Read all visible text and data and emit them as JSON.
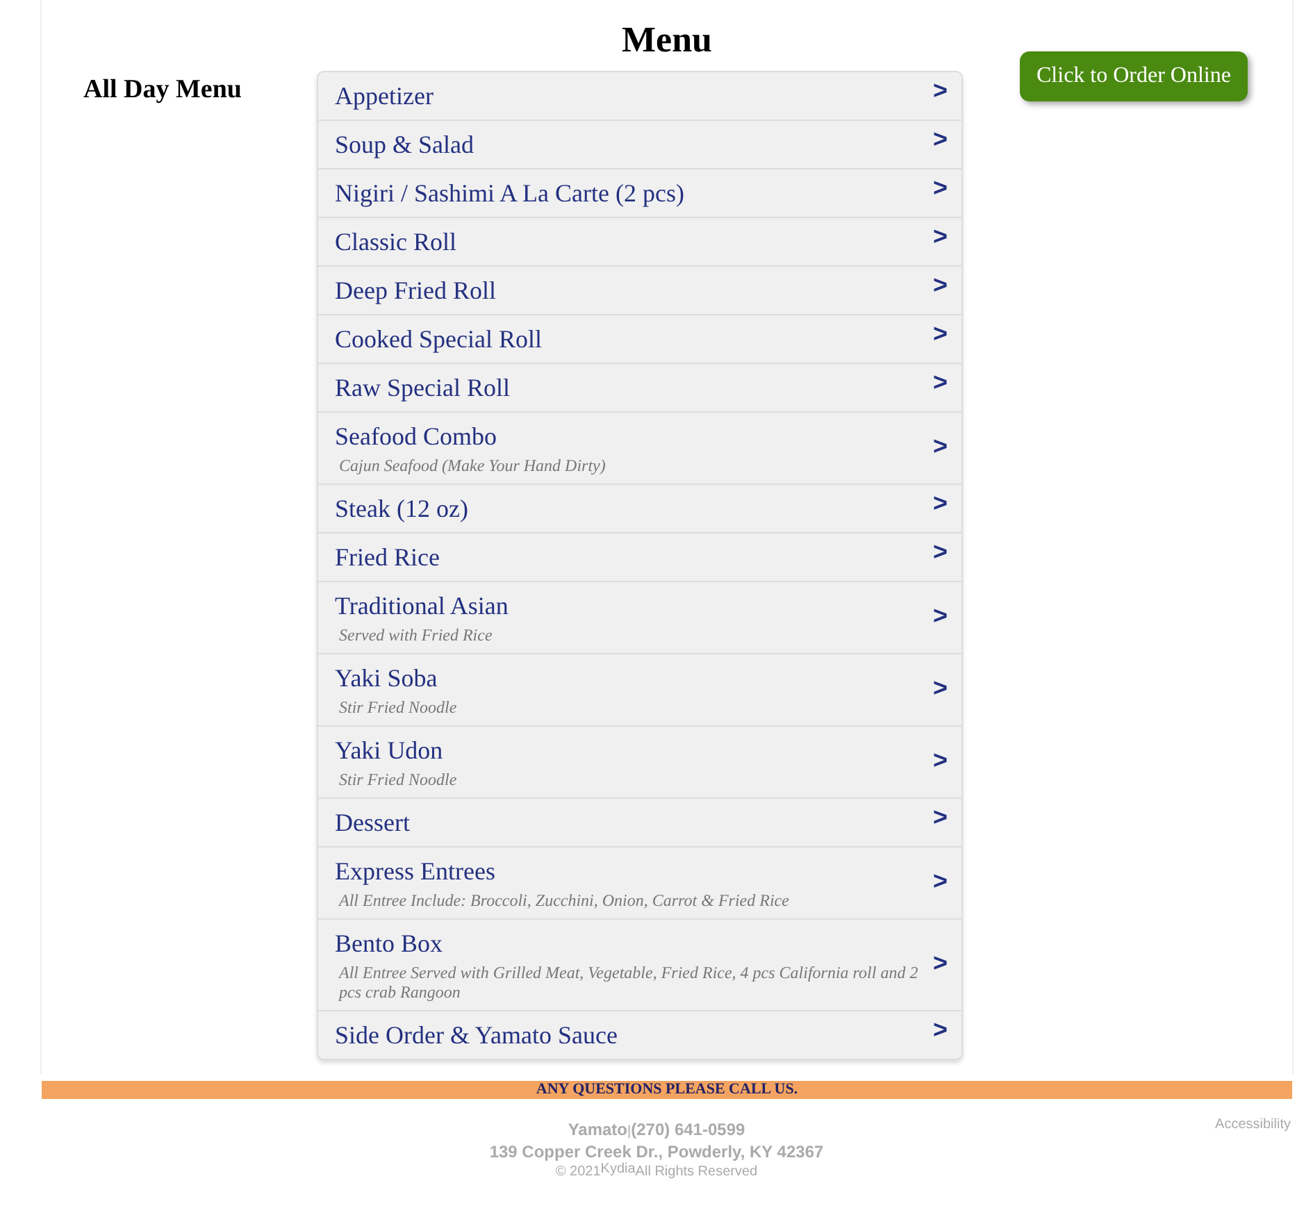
{
  "title": "Menu",
  "section": "All Day Menu",
  "order_button": "Click to Order Online",
  "categories": [
    {
      "name": "Appetizer",
      "arrow": ">"
    },
    {
      "name": "Soup & Salad",
      "arrow": ">"
    },
    {
      "name": "Nigiri / Sashimi A La Carte (2 pcs)",
      "arrow": ">"
    },
    {
      "name": "Classic Roll",
      "arrow": ">"
    },
    {
      "name": "Deep Fried Roll",
      "arrow": ">"
    },
    {
      "name": "Cooked Special Roll",
      "arrow": ">"
    },
    {
      "name": "Raw Special Roll",
      "arrow": ">"
    },
    {
      "name": "Seafood Combo",
      "description": "Cajun Seafood (Make Your Hand Dirty)",
      "arrow": ">"
    },
    {
      "name": "Steak (12 oz)",
      "arrow": ">"
    },
    {
      "name": "Fried Rice",
      "arrow": ">"
    },
    {
      "name": "Traditional Asian",
      "description": "Served with Fried Rice",
      "arrow": ">"
    },
    {
      "name": "Yaki Soba",
      "description": "Stir Fried Noodle",
      "arrow": ">"
    },
    {
      "name": "Yaki Udon",
      "description": "Stir Fried Noodle",
      "arrow": ">"
    },
    {
      "name": "Dessert",
      "arrow": ">"
    },
    {
      "name": "Express Entrees",
      "description": "All Entree Include: Broccoli, Zucchini, Onion, Carrot & Fried Rice",
      "arrow": ">"
    },
    {
      "name": "Bento Box",
      "description": "All Entree Served with Grilled Meat, Vegetable, Fried Rice, 4 pcs California roll and 2 pcs crab Rangoon",
      "arrow": ">"
    },
    {
      "name": "Side Order & Yamato Sauce",
      "arrow": ">"
    }
  ],
  "banner": "ANY QUESTIONS PLEASE CALL US.",
  "footer": {
    "name": "Yamato",
    "separator": "|",
    "phone": "(270) 641-0599",
    "address": "139 Copper Creek Dr., Powderly, KY 42367",
    "copyright": "© 2021",
    "brand": "Kydia",
    "rights": "All Rights Reserved",
    "accessibility": "Accessibility"
  }
}
